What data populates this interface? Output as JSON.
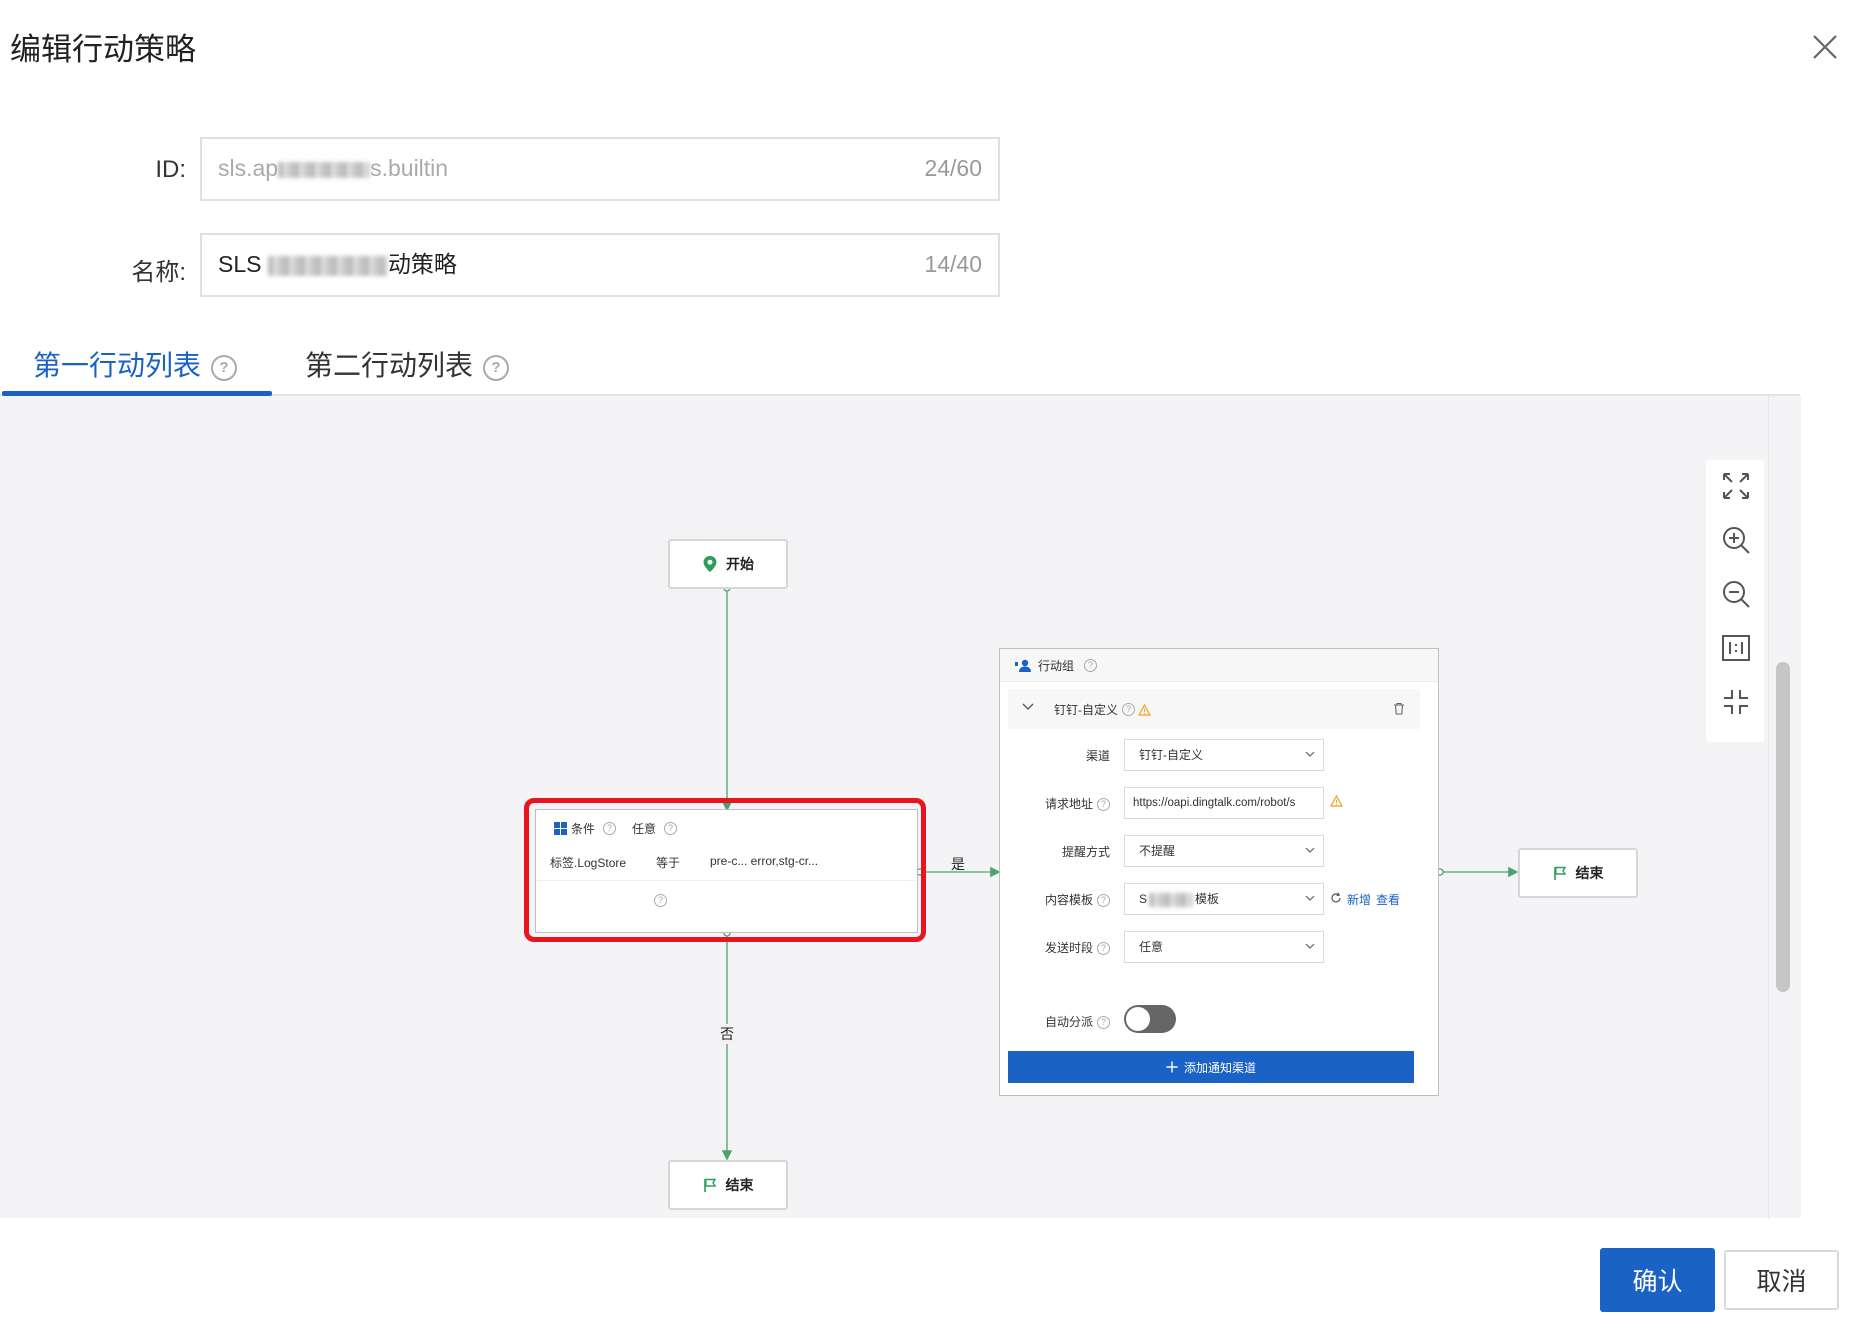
{
  "dialog": {
    "title": "编辑行动策略"
  },
  "form": {
    "id_label": "ID:",
    "id_value_start": "sls.ap",
    "id_value_end": "s.builtin",
    "id_count": "24/60",
    "name_label": "名称:",
    "name_value_start": "SLS",
    "name_value_end": "动策略",
    "name_count": "14/40"
  },
  "tabs": [
    {
      "label": "第一行动列表",
      "active": true
    },
    {
      "label": "第二行动列表",
      "active": false
    }
  ],
  "flow": {
    "start_label": "开始",
    "end_label": "结束",
    "yes_label": "是",
    "no_label": "否",
    "condition": {
      "title": "条件",
      "mode": "任意",
      "field": "标签.LogStore",
      "operator": "等于",
      "value": "pre-c... error,stg-cr..."
    },
    "action_group": {
      "title": "行动组",
      "channel_title": "钉钉-自定义",
      "rows": {
        "channel_label": "渠道",
        "channel_value": "钉钉-自定义",
        "url_label": "请求地址",
        "url_value": "https://oapi.dingtalk.com/robot/s",
        "remind_label": "提醒方式",
        "remind_value": "不提醒",
        "template_label": "内容模板",
        "template_value_start": "S",
        "template_value_end": "模板",
        "template_add": "新增",
        "template_view": "查看",
        "period_label": "发送时段",
        "period_value": "任意",
        "auto_label": "自动分派"
      },
      "add_channel": "添加通知渠道"
    }
  },
  "footer": {
    "confirm": "确认",
    "cancel": "取消"
  },
  "colors": {
    "primary": "#1a62c6",
    "highlight": "#e8141f",
    "flow_line": "#4aa36a",
    "warning": "#f0a020"
  }
}
